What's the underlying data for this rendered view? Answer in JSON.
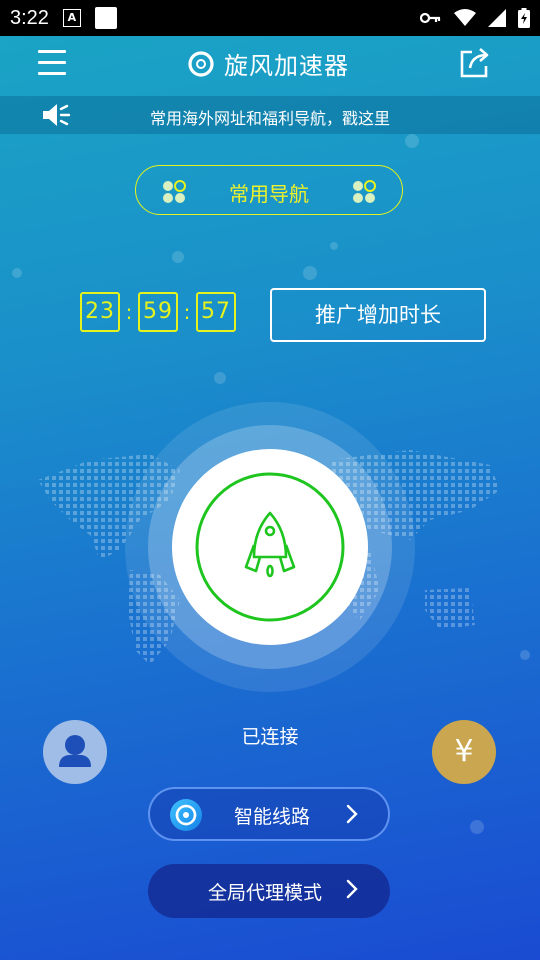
{
  "status_bar": {
    "time": "3:22",
    "notification_icon": "A",
    "icons": [
      "key-icon",
      "wifi-icon",
      "signal-icon",
      "battery-icon"
    ]
  },
  "app_bar": {
    "title": "旋风加速器",
    "menu_icon": "hamburger-icon",
    "share_icon": "share-icon"
  },
  "notice": {
    "icon": "speaker-icon",
    "text": "常用海外网址和福利导航，戳这里"
  },
  "nav_pill": {
    "label": "常用导航"
  },
  "timer": {
    "hours": "23",
    "minutes": "59",
    "seconds": "57",
    "separator": ":"
  },
  "promo_button": {
    "label": "推广增加时长"
  },
  "connect": {
    "status": "已连接",
    "icon": "rocket-icon"
  },
  "side_buttons": {
    "profile_icon": "user-icon",
    "recharge_symbol": "¥"
  },
  "route_button": {
    "label": "智能线路"
  },
  "mode_button": {
    "label": "全局代理模式"
  },
  "colors": {
    "accent_yellow": "#e6f21d",
    "connect_green": "#1ec51e",
    "coin_gold": "#c9a64f",
    "avatar_blue": "#9fbde6"
  }
}
